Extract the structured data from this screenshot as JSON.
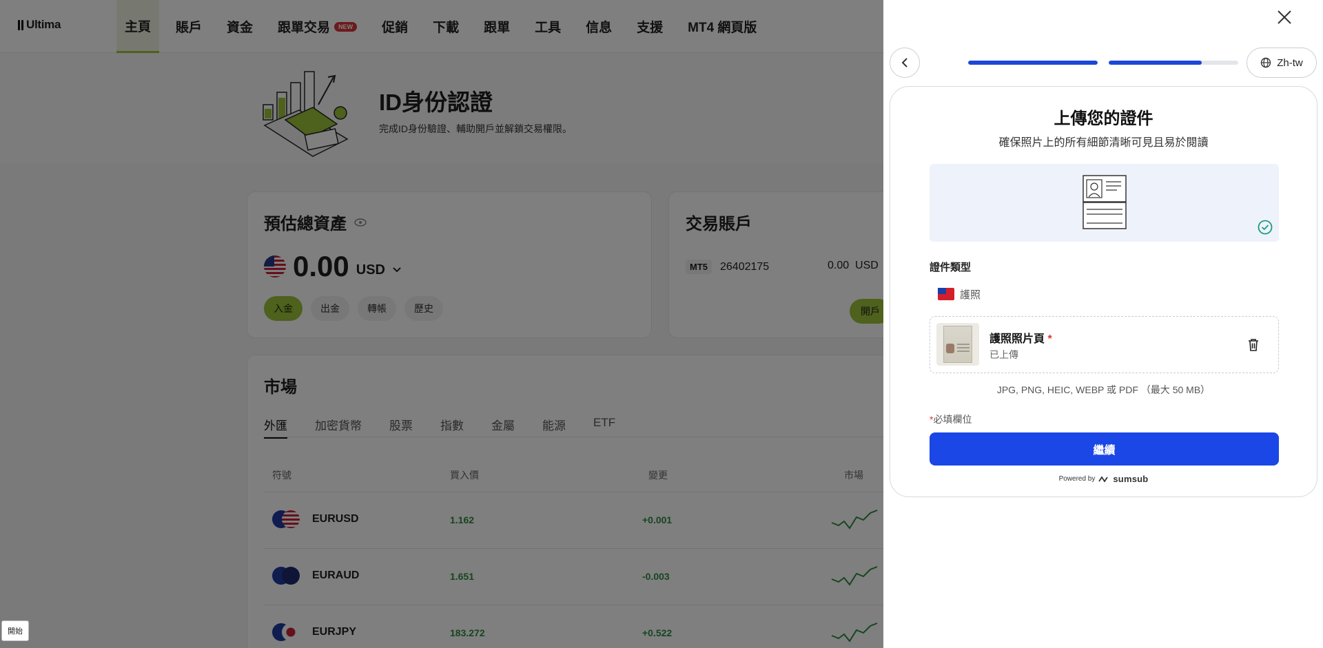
{
  "nav": {
    "logo": "Ultima",
    "items": [
      {
        "label": "主頁"
      },
      {
        "label": "賬戶"
      },
      {
        "label": "資金"
      },
      {
        "label": "跟單交易",
        "badge": "NEW"
      },
      {
        "label": "促銷"
      },
      {
        "label": "下載"
      },
      {
        "label": "跟單"
      },
      {
        "label": "工具"
      },
      {
        "label": "信息"
      },
      {
        "label": "支援"
      },
      {
        "label": "MT4 網頁版"
      }
    ]
  },
  "hero": {
    "title": "ID身份認證",
    "subtitle": "完成ID身份驗證、輔助開戶並解鎖交易權限。"
  },
  "assets": {
    "title": "預估總資產",
    "value": "0.00",
    "currency": "USD",
    "buttons": [
      "入金",
      "出金",
      "轉帳",
      "歷史"
    ]
  },
  "trading_account": {
    "title": "交易賬戶",
    "platform": "MT5",
    "number": "26402175",
    "balance": "0.00",
    "currency": "USD",
    "open_label": "開戶"
  },
  "market": {
    "title": "市場",
    "tabs": [
      "外匯",
      "加密貨幣",
      "股票",
      "指數",
      "金屬",
      "能源",
      "ETF"
    ],
    "headers": [
      "符號",
      "買入價",
      "變更",
      "市場"
    ],
    "rows": [
      {
        "symbol": "EURUSD",
        "bid": "1.162",
        "change": "+0.001"
      },
      {
        "symbol": "EURAUD",
        "bid": "1.651",
        "change": "-0.003"
      },
      {
        "symbol": "EURJPY",
        "bid": "183.272",
        "change": "+0.522"
      }
    ]
  },
  "taskbar": {
    "start_label": "開始"
  },
  "drawer": {
    "language": "Zh-tw",
    "progress": [
      1.0,
      0.72
    ],
    "title": "上傳您的證件",
    "subtitle": "確保照片上的所有細節清晰可見且易於閱讀",
    "doc_type_label": "證件類型",
    "doc_type_value": "護照",
    "upload_title": "護照照片頁",
    "required_mark": "*",
    "upload_status": "已上傳",
    "formats": "JPG, PNG, HEIC, WEBP 或 PDF （最大 50 MB）",
    "required_note": "必填欄位",
    "continue_label": "繼續",
    "powered_by": "Powered by",
    "brand": "sumsub",
    "accent_color": "#1b47e6"
  }
}
